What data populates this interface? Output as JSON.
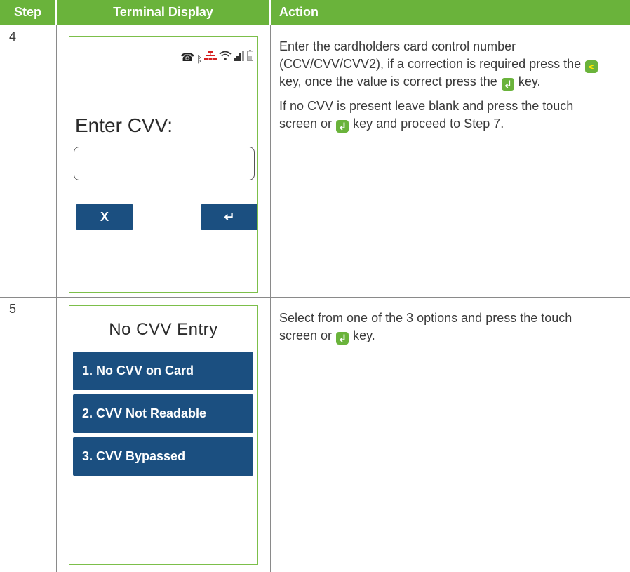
{
  "header": {
    "step": "Step",
    "terminal_display": "Terminal Display",
    "action": "Action"
  },
  "colors": {
    "header_bg": "#6ab33b",
    "button_blue": "#1b4f80",
    "screen_border": "#7cbf4a"
  },
  "rows": [
    {
      "step": "4",
      "screen": {
        "status_icons": [
          "phone-icon",
          "bluetooth-icon",
          "ethernet-icon",
          "wifi-icon",
          "signal-icon",
          "battery-icon"
        ],
        "prompt": "Enter CVV:",
        "input_value": "",
        "cancel_label": "X",
        "enter_label": "↵"
      },
      "action": {
        "p1_a": "Enter the cardholders card control number (CCV/CVV/CVV2), if a correction is required press the",
        "p1_b": "key, once the value is correct press the",
        "p1_c": "key.",
        "p2_a": "If no CVV is present leave blank and press the touch screen or",
        "p2_b": "key and proceed to Step 7."
      }
    },
    {
      "step": "5",
      "screen": {
        "title": "No CVV Entry",
        "options": [
          "1. No CVV on Card",
          "2. CVV Not Readable",
          "3. CVV Bypassed"
        ]
      },
      "action": {
        "p1_a": "Select from one of the 3 options and press the touch screen or",
        "p1_b": "key."
      }
    }
  ]
}
